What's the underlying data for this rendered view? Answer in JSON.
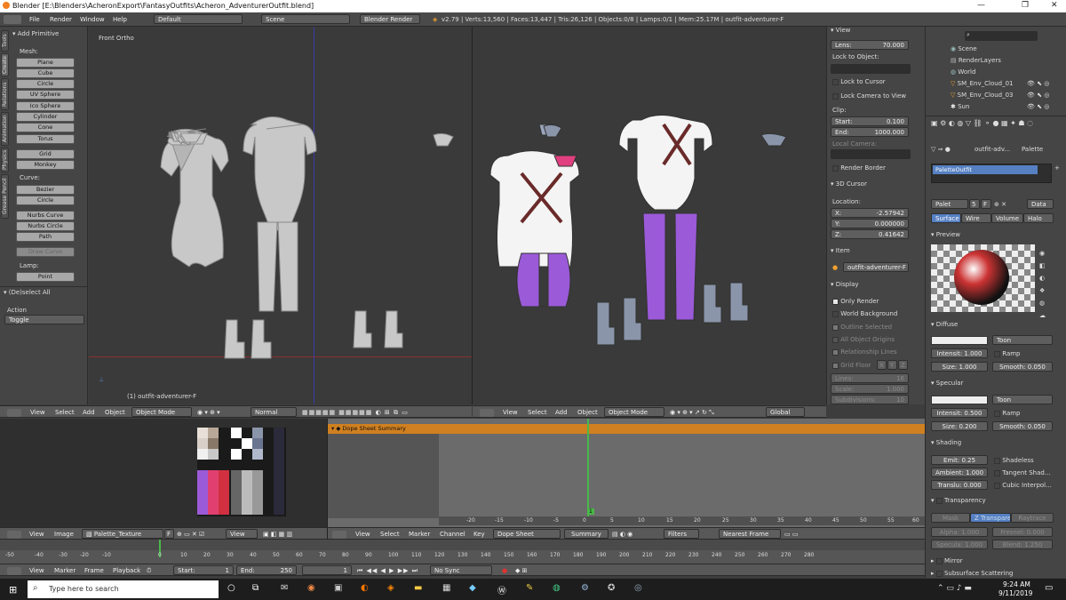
{
  "window": {
    "title": "Blender [E:\\Blenders\\AcheronExport\\FantasyOutfits\\Acheron_AdventurerOutfit.blend]",
    "min": "—",
    "max": "❐",
    "close": "✕"
  },
  "info": {
    "menus": [
      "File",
      "Render",
      "Window",
      "Help"
    ],
    "layout": "Default",
    "scene": "Scene",
    "engine": "Blender Render",
    "stats": "v2.79 | Verts:13,560 | Faces:13,447 | Tris:26,126 | Objects:0/8 | Lamps:0/1 | Mem:25.17M | outfit-adventurer-F"
  },
  "toolshelf": {
    "tabs": [
      "Tools",
      "Create",
      "Relations",
      "Animation",
      "Physics",
      "Grease Pencil"
    ],
    "title": "Add Primitive",
    "mesh_label": "Mesh:",
    "mesh": [
      "Plane",
      "Cube",
      "Circle",
      "UV Sphere",
      "Ico Sphere",
      "Cylinder",
      "Cone",
      "Torus"
    ],
    "mesh2": [
      "Grid",
      "Monkey"
    ],
    "curve_label": "Curve:",
    "curve": [
      "Bezier",
      "Circle"
    ],
    "nurbs": [
      "Nurbs Curve",
      "Nurbs Circle",
      "Path"
    ],
    "draw_curve": "Draw Curve",
    "lamp_label": "Lamp:",
    "lamp": "Point",
    "op_title": "(De)select All",
    "action_label": "Action",
    "action_value": "Toggle"
  },
  "viewport_left": {
    "view_name": "Front Ortho",
    "object_label": "(1) outfit-adventurer-F"
  },
  "npanel": {
    "view_title": "View",
    "lens_label": "Lens:",
    "lens": "70.000",
    "lock_object": "Lock to Object:",
    "lock_cursor": "Lock to Cursor",
    "lock_camera": "Lock Camera to View",
    "clip": "Clip:",
    "start_label": "Start:",
    "start": "0.100",
    "end_label": "End:",
    "end": "1000.000",
    "local_camera": "Local Camera:",
    "render_border": "Render Border",
    "cursor_title": "3D Cursor",
    "location": "Location:",
    "x_label": "X:",
    "x": "-2.57942",
    "y_label": "Y:",
    "y": "0.000000",
    "z_label": "Z:",
    "z": "0.41642",
    "item_title": "Item",
    "item_name": "outfit-adventurer-F",
    "display_title": "Display",
    "only_render": "Only Render",
    "world_bg": "World Background",
    "outline_sel": "Outline Selected",
    "all_origins": "All Object Origins",
    "rel_lines": "Relationship Lines",
    "grid_floor": "Grid Floor",
    "gx": "X",
    "gy": "Y",
    "gz": "Z",
    "lines_label": "Lines:",
    "lines": "16",
    "scale_label": "Scale:",
    "scale": "1.000",
    "subdiv_label": "Subdivisions:",
    "subdiv": "10"
  },
  "outliner": {
    "search_placeholder": "",
    "items": [
      "Scene",
      "RenderLayers",
      "World",
      "SM_Env_Cloud_01",
      "SM_Env_Cloud_03",
      "Sun"
    ]
  },
  "properties": {
    "breadcrumb_obj": "outfit-adv...",
    "breadcrumb_mat": "Palette",
    "material_slot": "PaletteOutfit",
    "mat_name": "Palet",
    "users": "5",
    "fake": "F",
    "data": "Data",
    "tabs": [
      "Surface",
      "Wire",
      "Volume",
      "Halo"
    ],
    "preview_title": "Preview",
    "diffuse_title": "Diffuse",
    "diffuse_shader": "Toon",
    "intensity": "Intensit: 1.000",
    "ramp": "Ramp",
    "size": "Size: 1.000",
    "smooth": "Smooth: 0.050",
    "specular_title": "Specular",
    "spec_shader": "Toon",
    "spec_intensity": "Intensit: 0.500",
    "spec_ramp": "Ramp",
    "spec_size": "Size: 0.200",
    "spec_smooth": "Smooth: 0.050",
    "shading_title": "Shading",
    "emit": "Emit: 0.25",
    "shadeless": "Shadeless",
    "ambient": "Ambient: 1.000",
    "tangent": "Tangent Shad...",
    "translu": "Translu: 0.000",
    "cubic": "Cubic Interpol...",
    "transparency_title": "Transparency",
    "t_tabs": [
      "Mask",
      "Z Transparen...",
      "Raytrace"
    ],
    "alpha": "Alpha: 1.000",
    "fresnel": "Fresnel: 0.000",
    "specular_t": "Specula: 1.000",
    "blend": "Blend: 1.250",
    "mirror": "Mirror",
    "sss": "Subsurface Scattering"
  },
  "header3d": {
    "menus": [
      "View",
      "Select",
      "Add",
      "Object"
    ],
    "mode": "Object Mode",
    "shading": "Normal",
    "orientation": "Global"
  },
  "image_editor": {
    "menus": [
      "View",
      "Image"
    ],
    "image": "Palette_Texture",
    "fake": "F",
    "view": "View"
  },
  "dopesheet": {
    "channel": "Dope Sheet Summary",
    "menus": [
      "View",
      "Select",
      "Marker",
      "Channel",
      "Key"
    ],
    "mode": "Dope Sheet",
    "summary": "Summary",
    "filters": "Filters",
    "snap": "Nearest Frame",
    "ticks": [
      "-20",
      "-15",
      "-10",
      "-5",
      "0",
      "5",
      "10",
      "15",
      "20",
      "25",
      "30",
      "35",
      "40",
      "45",
      "50",
      "55",
      "60",
      "65"
    ],
    "current": "1"
  },
  "timeline": {
    "ticks": [
      "-50",
      "-40",
      "-30",
      "-20",
      "-10",
      "0",
      "10",
      "20",
      "30",
      "40",
      "50",
      "60",
      "70",
      "80",
      "90",
      "100",
      "110",
      "120",
      "130",
      "140",
      "150",
      "160",
      "170",
      "180",
      "190",
      "200",
      "210",
      "220",
      "230",
      "240",
      "250",
      "260",
      "270",
      "280"
    ],
    "menus": [
      "View",
      "Marker",
      "Frame",
      "Playback"
    ],
    "start": "Start:",
    "start_val": "1",
    "end": "End:",
    "end_val": "250",
    "frame": "1",
    "sync": "No Sync"
  },
  "taskbar": {
    "search": "Type here to search",
    "time": "9:24 AM",
    "date": "9/11/2019"
  },
  "colors": {
    "accent": "#5680c2",
    "orange": "#f0a030",
    "panel": "#454545"
  }
}
